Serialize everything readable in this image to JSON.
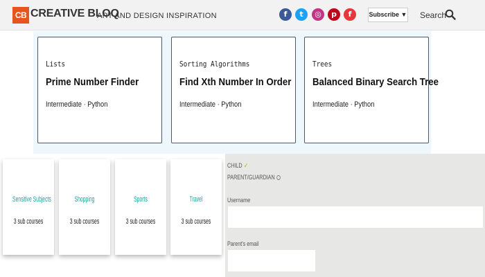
{
  "header": {
    "logo_mark": "CB",
    "logo_text": "CREATIVE BLOQ",
    "tagline": "ART AND DESIGN INSPIRATION",
    "social": [
      {
        "name": "facebook",
        "glyph": "f",
        "color": "#3b5998"
      },
      {
        "name": "twitter",
        "glyph": "t",
        "color": "#1da1f2"
      },
      {
        "name": "instagram",
        "glyph": "◎",
        "color": "#c13584"
      },
      {
        "name": "pinterest",
        "glyph": "p",
        "color": "#bd081c"
      },
      {
        "name": "flipboard",
        "glyph": "f",
        "color": "#e5383b"
      }
    ],
    "subscribe_label": "Subscribe ▼",
    "search_label": "Search",
    "search_icon": "search-icon"
  },
  "courses": [
    {
      "category": "Lists",
      "title": "Prime Number Finder",
      "meta": "Intermediate · Python"
    },
    {
      "category": "Sorting Algorithms",
      "title": "Find Xth Number In Order",
      "meta": "Intermediate · Python"
    },
    {
      "category": "Trees",
      "title": "Balanced Binary Search Tree",
      "meta": "Intermediate · Python"
    }
  ],
  "subjects": [
    {
      "name": "Sensitive Subjects",
      "count": "3 sub courses"
    },
    {
      "name": "Shopping",
      "count": "3 sub courses"
    },
    {
      "name": "Sports",
      "count": "3 sub courses"
    },
    {
      "name": "Travel",
      "count": "3 sub courses"
    }
  ],
  "form": {
    "option_child": "CHILD",
    "option_parent": "PARENT/GUARDIAN",
    "username_label": "Username",
    "username_value": "",
    "parent_email_label": "Parent's email",
    "parent_email_value": ""
  },
  "colors": {
    "brand": "#e8541e",
    "subject_text": "#1aa39a",
    "band_bg": "#eef7fb",
    "form_bg": "#e7e8e5"
  }
}
